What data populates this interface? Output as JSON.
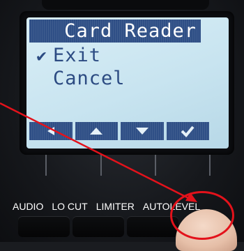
{
  "screen": {
    "title": "Card Reader",
    "menu": [
      {
        "label": "Exit",
        "selected": true
      },
      {
        "label": "Cancel",
        "selected": false
      }
    ],
    "softkeys": [
      {
        "icon": "arrow-left-icon"
      },
      {
        "icon": "arrow-up-icon"
      },
      {
        "icon": "arrow-down-icon"
      },
      {
        "icon": "checkmark-icon"
      }
    ],
    "check_glyph": "✔"
  },
  "hardware_buttons": {
    "audio": "AUDIO",
    "locut": "LO CUT",
    "limiter": "LIMITER",
    "autolevel": "AUTOLEVEL"
  },
  "annotation": {
    "color": "#e3121b",
    "highlight_target": "AUTOLEVEL"
  }
}
